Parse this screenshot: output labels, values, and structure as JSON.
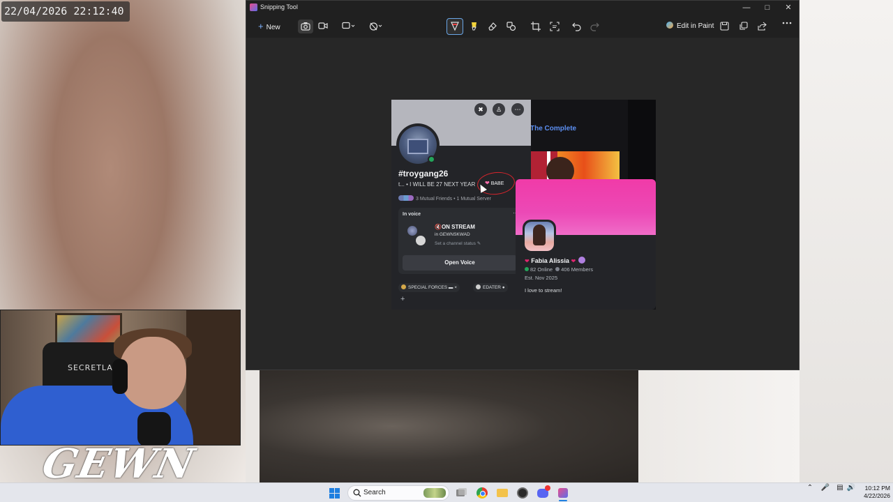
{
  "overlay": {
    "timestamp": "22/04/2026 22:12:40",
    "stream_logo": "GEWN",
    "chair_brand": "SECRETLAB"
  },
  "snipping_tool": {
    "title": "Snipping Tool",
    "new_label": "New",
    "edit_in_paint_label": "Edit in Paint",
    "icons": [
      "camera-icon",
      "video-icon",
      "rectangle-snip-icon",
      "timer-icon",
      "ballpoint-pen-icon",
      "highlighter-icon",
      "eraser-icon",
      "shapes-icon",
      "crop-icon",
      "text-actions-icon",
      "undo-icon",
      "redo-icon",
      "save-icon",
      "copy-icon",
      "share-icon",
      "more-icon"
    ]
  },
  "capture": {
    "bg_link_text": "The Complete",
    "profile": {
      "username": "#troygang26",
      "status": "t... • I WILL BE 27 NEXT YEAR",
      "badge": "BABE",
      "mutual": "3 Mutual Friends • 1 Mutual Server",
      "voice": {
        "label": "In voice",
        "title": "🔇ON STREAM",
        "server": "in GEWNSKWAD",
        "status": "Set a channel status ✎",
        "button": "Open Voice"
      },
      "tags": [
        {
          "label": "SPECIAL FORCES",
          "dot_color": "#d4a84a"
        },
        {
          "label": "EDATER",
          "dot_color": "#cfcfcf"
        }
      ],
      "add_tag": "+"
    },
    "server": {
      "name": "Fabia Alissia",
      "online": "82 Online",
      "members": "406 Members",
      "established": "Est. Nov 2025",
      "description": "I love to stream!"
    }
  },
  "taskbar": {
    "search_placeholder": "Search",
    "time": "10:12 PM",
    "date": "4/22/2026"
  },
  "colors": {
    "accent": "#1f7fe0",
    "discord_bg": "#232428",
    "server_banner": "#f03ba8",
    "online_green": "#23a55a",
    "annotation_red": "#d8242c"
  }
}
